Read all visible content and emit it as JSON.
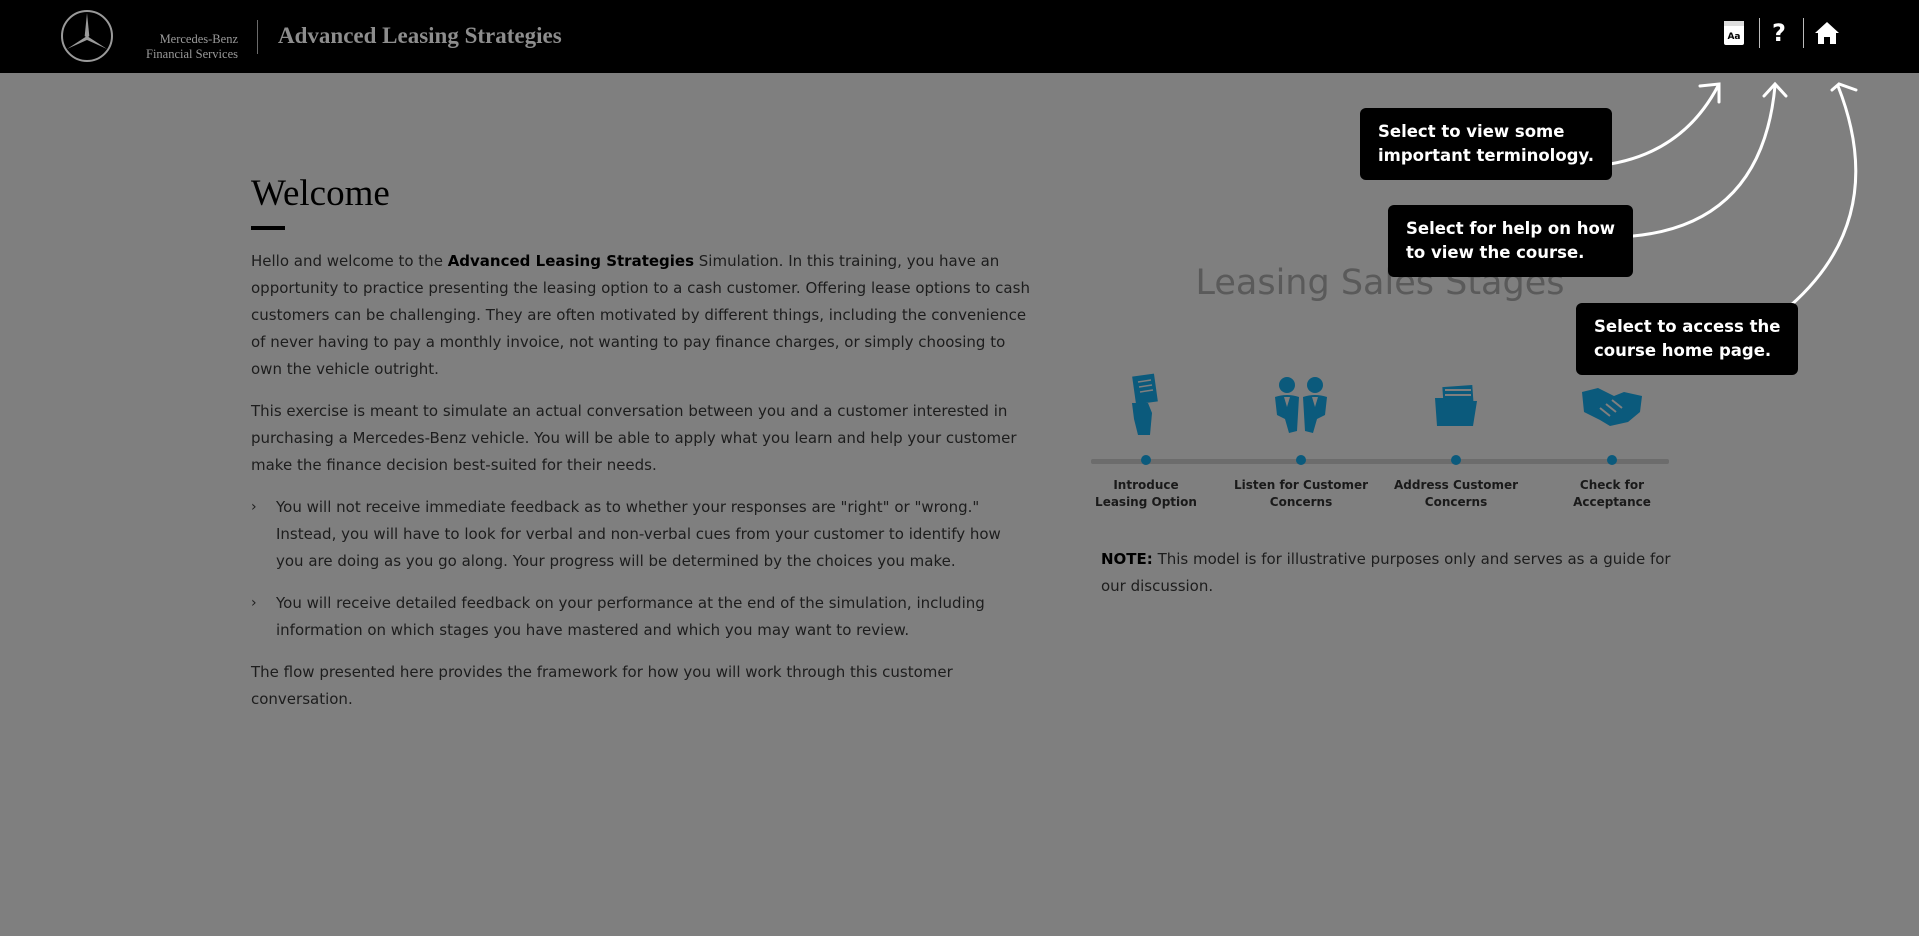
{
  "header": {
    "brand_line1": "Mercedes-Benz",
    "brand_line2": "Financial Services",
    "app_title": "Advanced Leasing Strategies",
    "icons": [
      "glossary-icon",
      "help-icon",
      "home-icon"
    ]
  },
  "main": {
    "heading": "Welcome",
    "p1_pre": "Hello and welcome to the ",
    "p1_bold": "Advanced Leasing Strategies",
    "p1_post": " Simulation. In this training, you have an opportunity to practice presenting the leasing option to a cash customer. Offering lease options to cash customers can be challenging. They are often motivated by different things, including the convenience of never having to pay a monthly invoice, not wanting to pay finance charges, or simply choosing to own the vehicle outright.",
    "p2": "This exercise is meant to simulate an actual conversation between you and a customer interested in purchasing a Mercedes-Benz vehicle. You will be able to apply what you learn and help your customer make the finance decision best-suited for their needs.",
    "bullets": [
      "You will not receive immediate feedback as to whether your responses are \"right\" or \"wrong.\" Instead, you will have to look for verbal and non-verbal cues from your customer to identify how you are doing as you go along. Your progress will be determined by the choices you make.",
      "You will receive detailed feedback on your performance at the end of the simulation, including information on which stages you have mastered and which you may want to review."
    ],
    "p3": "The flow presented here provides the framework for how you will work through this customer conversation."
  },
  "stages": {
    "title": "Leasing Sales Stages",
    "items": [
      {
        "label_line1": "Introduce",
        "label_line2": "Leasing Option",
        "icon": "document-hand-icon"
      },
      {
        "label_line1": "Listen for Customer",
        "label_line2": "Concerns",
        "icon": "two-people-icon"
      },
      {
        "label_line1": "Address Customer",
        "label_line2": "Concerns",
        "icon": "folder-icon"
      },
      {
        "label_line1": "Check for",
        "label_line2": "Acceptance",
        "icon": "handshake-icon"
      }
    ],
    "note_label": "NOTE:",
    "note_text": " This model is for illustrative purposes only and serves as a guide for our discussion."
  },
  "callouts": {
    "terminology_line1": "Select to view some",
    "terminology_line2": "important terminology.",
    "help_line1": "Select for help on how",
    "help_line2": "to view the course.",
    "home_line1": "Select to access the",
    "home_line2": "course home page."
  },
  "colors": {
    "overlay": "#7f7f7f",
    "header": "#000000",
    "stage_icon": "#0b5a7c"
  }
}
